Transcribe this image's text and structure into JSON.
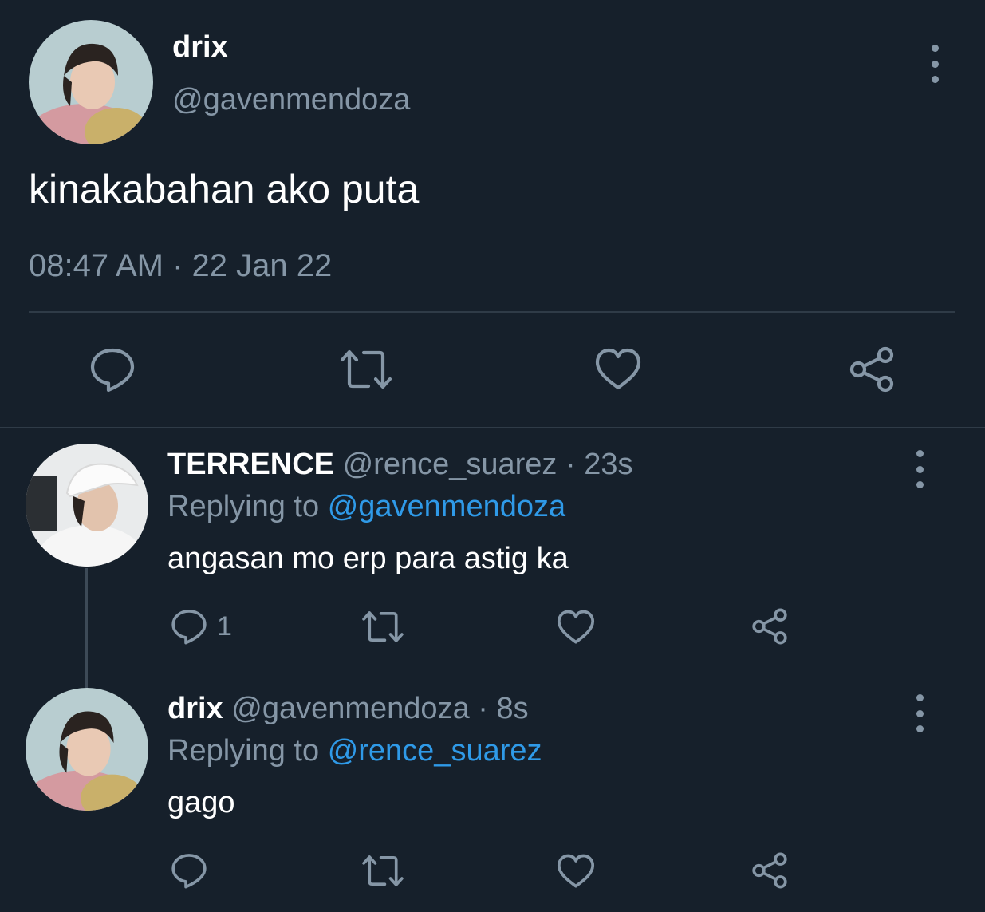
{
  "main_tweet": {
    "name": "drix",
    "handle": "@gavenmendoza",
    "text": "kinakabahan ako puta",
    "timestamp": "08:47 AM · 22 Jan 22",
    "actions": {
      "reply_icon": "speech-bubble-icon",
      "retweet_icon": "retweet-icon",
      "like_icon": "heart-icon",
      "share_icon": "share-icon"
    }
  },
  "replies": [
    {
      "name": "TERRENCE",
      "handle": "@rence_suarez",
      "separator": "·",
      "time": "23s",
      "replying_prefix": "Replying to",
      "replying_to": "@gavenmendoza",
      "text": "angasan mo erp para astig ka",
      "reply_count": "1"
    },
    {
      "name": "drix",
      "handle": "@gavenmendoza",
      "separator": "·",
      "time": "8s",
      "replying_prefix": "Replying to",
      "replying_to": "@rence_suarez",
      "text": "gago",
      "reply_count": ""
    }
  ],
  "colors": {
    "background": "#16202b",
    "text_primary": "#ffffff",
    "text_secondary": "#8596a6",
    "accent_link": "#2f9ae8",
    "divider": "#2f3b47"
  }
}
